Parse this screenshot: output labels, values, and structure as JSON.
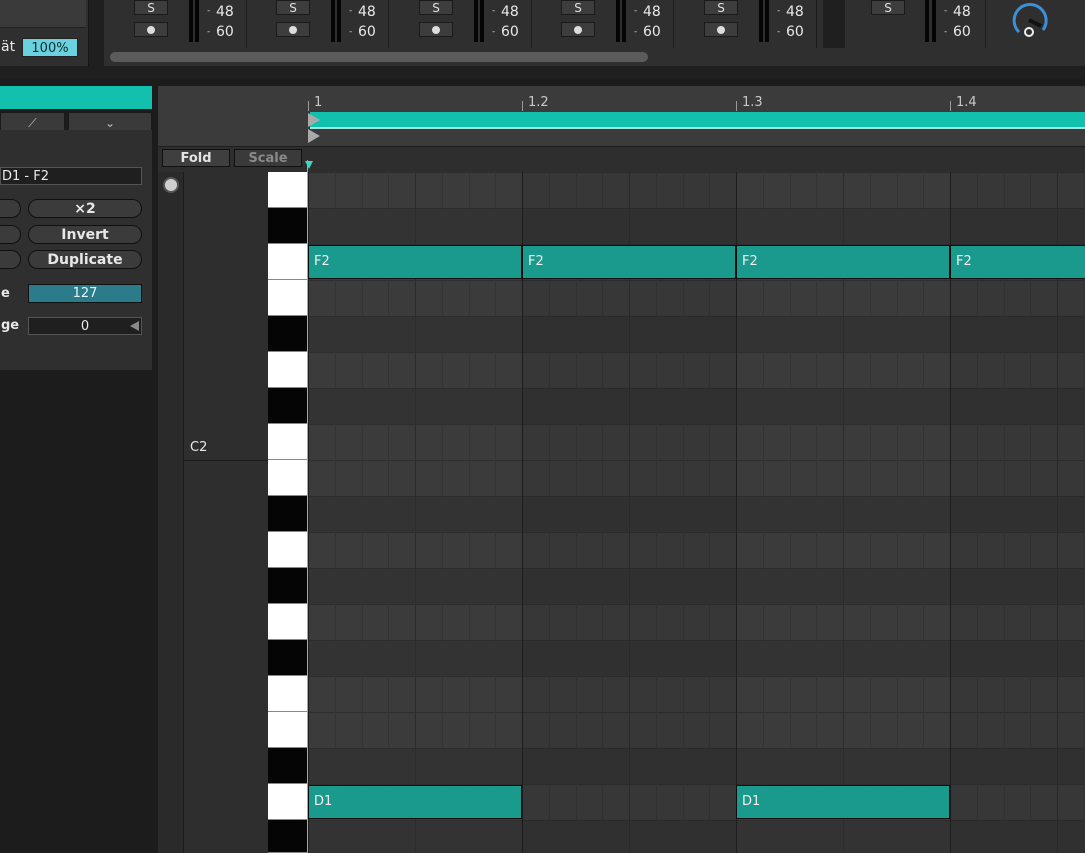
{
  "mixer": {
    "left_label": "ät",
    "percent": "100%",
    "channels": [
      {
        "solo": "S",
        "tick_top": "-",
        "tick_bottom": "-",
        "val_top": "48",
        "val_bottom": "60"
      },
      {
        "solo": "S",
        "tick_top": "-",
        "tick_bottom": "-",
        "val_top": "48",
        "val_bottom": "60"
      },
      {
        "solo": "S",
        "tick_top": "-",
        "tick_bottom": "-",
        "val_top": "48",
        "val_bottom": "60"
      },
      {
        "solo": "S",
        "tick_top": "-",
        "tick_bottom": "-",
        "val_top": "48",
        "val_bottom": "60"
      },
      {
        "solo": "S",
        "tick_top": "-",
        "tick_bottom": "-",
        "val_top": "48",
        "val_bottom": "60"
      },
      {
        "solo": "S",
        "tick_top": "-",
        "tick_bottom": "-",
        "val_top": "48",
        "val_bottom": "60"
      }
    ],
    "icons": [
      "metronome-icon",
      "knob-icon"
    ]
  },
  "left_panel": {
    "note_range": "D1 - F2",
    "buttons": {
      "double": "×2",
      "invert": "Invert",
      "duplicate": "Duplicate"
    },
    "velocity_label": "e",
    "velocity_value": "127",
    "range_label": "ge",
    "range_value": "0"
  },
  "roll": {
    "ruler": [
      "1",
      "1.2",
      "1.3",
      "1.4"
    ],
    "fold": "Fold",
    "scale": "Scale",
    "key_label": "C2",
    "notes": [
      {
        "pitch": "F2",
        "label": "F2",
        "start": 1.0,
        "length": 0.25
      },
      {
        "pitch": "F2",
        "label": "F2",
        "start": 1.25,
        "length": 0.25
      },
      {
        "pitch": "F2",
        "label": "F2",
        "start": 1.5,
        "length": 0.25
      },
      {
        "pitch": "F2",
        "label": "F2",
        "start": 1.75,
        "length": 0.25
      },
      {
        "pitch": "D1",
        "label": "D1",
        "start": 1.0,
        "length": 0.25
      },
      {
        "pitch": "D1",
        "label": "D1",
        "start": 1.5,
        "length": 0.25
      }
    ],
    "colors": {
      "accent": "#12c0ae",
      "note": "#1a9a8c"
    }
  }
}
